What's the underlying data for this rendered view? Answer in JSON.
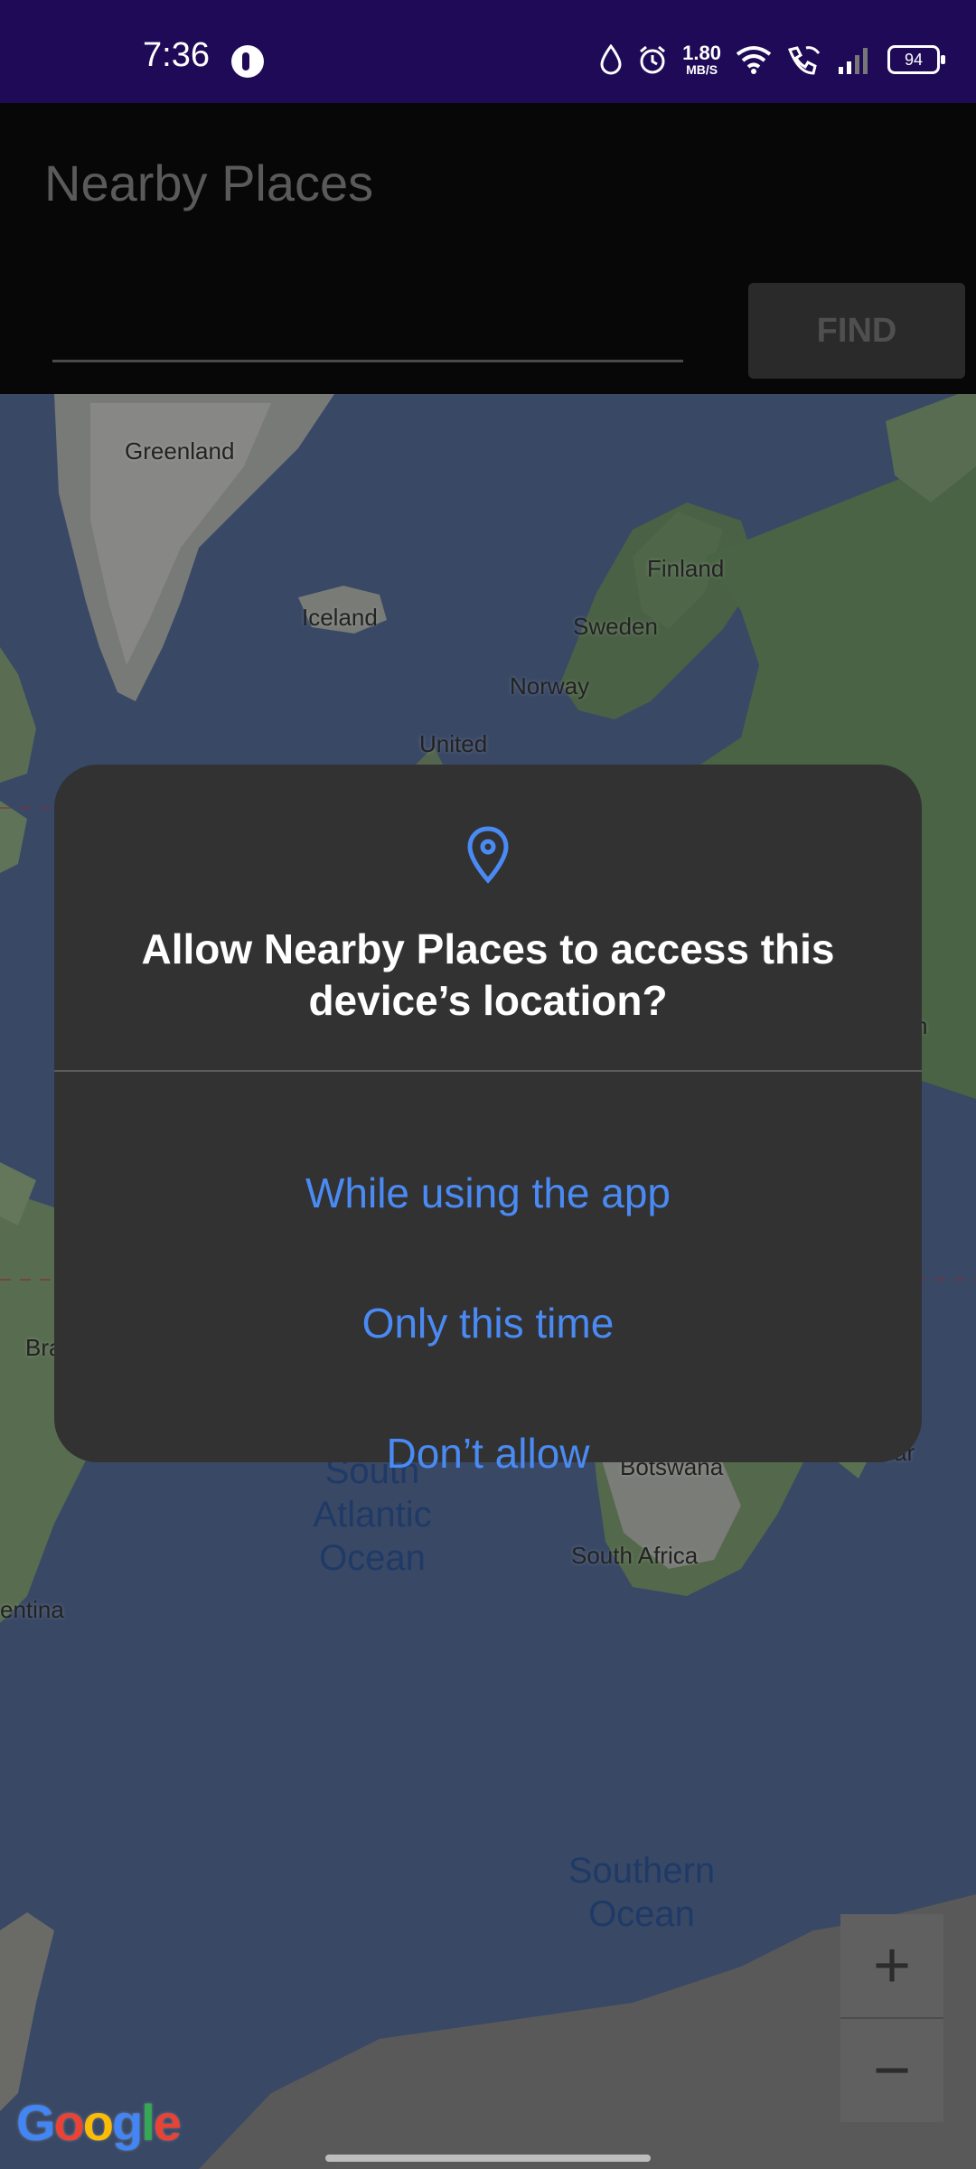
{
  "status_bar": {
    "time": "7:36",
    "net_speed_value": "1.80",
    "net_speed_unit": "MB/S",
    "battery": "94"
  },
  "app": {
    "title": "Nearby Places",
    "search_value": "",
    "find_label": "FIND"
  },
  "map": {
    "labels": {
      "greenland": "Greenland",
      "iceland": "Iceland",
      "finland": "Finland",
      "sweden": "Sweden",
      "norway": "Norway",
      "united": "United",
      "botswana": "Botswana",
      "south_africa": "South Africa",
      "brazil_partial": "Bra",
      "argentina_partial": "entina",
      "madagascar_partial": "car",
      "right_partial": "n"
    },
    "oceans": {
      "south_atlantic_1": "South",
      "south_atlantic_2": "Atlantic",
      "south_atlantic_3": "Ocean",
      "southern_1": "Southern",
      "southern_2": "Ocean"
    },
    "zoom_in": "+",
    "zoom_out": "−",
    "logo_letters": [
      "G",
      "o",
      "o",
      "g",
      "l",
      "e"
    ],
    "logo_colors": [
      "#4285f4",
      "#ea4335",
      "#fbbc05",
      "#4285f4",
      "#34a853",
      "#ea4335"
    ]
  },
  "dialog": {
    "icon": "location-pin-icon",
    "title": "Allow Nearby Places to access this device’s location?",
    "options": {
      "while_using": "While using the app",
      "only_this_time": "Only this time",
      "dont_allow": "Don’t allow"
    },
    "accent_color": "#4a8af4"
  }
}
